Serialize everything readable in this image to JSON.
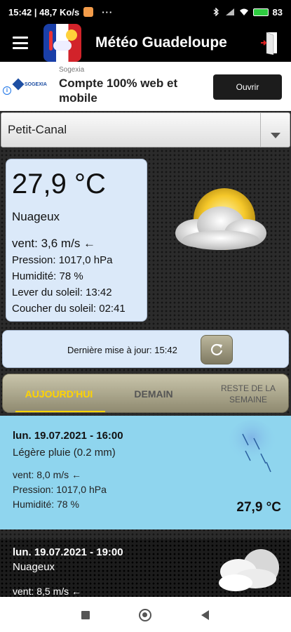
{
  "status_bar": {
    "time_speed": "15:42 | 48,7 Ko/s",
    "dots": "···",
    "battery": "83"
  },
  "app_bar": {
    "title": "Météo Guadeloupe"
  },
  "ad": {
    "sponsor": "Sogexia",
    "logo_text": "SOGEXIA",
    "headline": "Compte 100% web et mobile",
    "button": "Ouvrir"
  },
  "location": {
    "selected": "Petit-Canal"
  },
  "current": {
    "temperature": "27,9 °C",
    "condition": "Nuageux",
    "wind": "vent: 3,6 m/s ←",
    "pressure": "Pression: 1017,0 hPa",
    "humidity": "Humidité: 78 %",
    "sunrise": "Lever du soleil: 13:42",
    "sunset": "Coucher du soleil: 02:41"
  },
  "update": {
    "text": "Dernière mise à jour: 15:42"
  },
  "tabs": {
    "today": "AUJOURD'HUI",
    "tomorrow": "DEMAIN",
    "rest_line1": "RESTE DE LA",
    "rest_line2": "SEMAINE"
  },
  "forecast": [
    {
      "date": "lun. 19.07.2021 - 16:00",
      "condition": "Légère pluie (0.2 mm)",
      "wind": "vent: 8,0 m/s ←",
      "pressure": "Pression: 1017,0 hPa",
      "humidity": "Humidité: 78 %",
      "temperature": "27,9 °C"
    },
    {
      "date": "lun. 19.07.2021 - 19:00",
      "condition": "Nuageux",
      "wind": "vent: 8,5 m/s ←"
    }
  ],
  "colors": {
    "accent_tab": "#ffd400",
    "forecast_bg": "#8fd5ee",
    "card_bg": "#dbe9f9"
  }
}
